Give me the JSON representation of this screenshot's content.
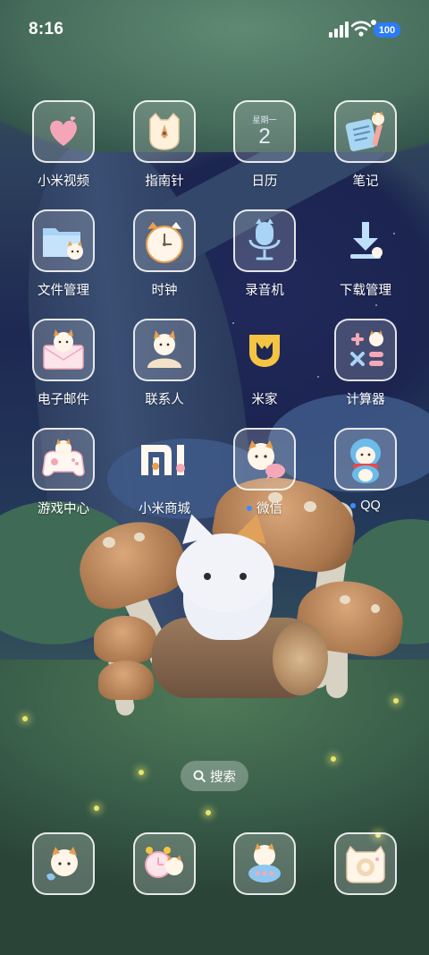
{
  "status_bar": {
    "time": "8:16",
    "battery_level": "100",
    "signal_icon": "cellular-signal-icon",
    "wifi_icon": "wifi-icon"
  },
  "apps": [
    {
      "id": "mi-video",
      "label": "小米视频",
      "icon": "heart-icon"
    },
    {
      "id": "compass",
      "label": "指南针",
      "icon": "compass-icon"
    },
    {
      "id": "calendar",
      "label": "日历",
      "icon": "calendar-icon",
      "weekday": "星期一",
      "day": "2"
    },
    {
      "id": "notes",
      "label": "笔记",
      "icon": "notes-icon"
    },
    {
      "id": "file-manager",
      "label": "文件管理",
      "icon": "folder-icon"
    },
    {
      "id": "clock",
      "label": "时钟",
      "icon": "clock-icon"
    },
    {
      "id": "recorder",
      "label": "录音机",
      "icon": "microphone-icon"
    },
    {
      "id": "downloads",
      "label": "下载管理",
      "icon": "download-icon"
    },
    {
      "id": "email",
      "label": "电子邮件",
      "icon": "envelope-icon"
    },
    {
      "id": "contacts",
      "label": "联系人",
      "icon": "contact-icon"
    },
    {
      "id": "mijia",
      "label": "米家",
      "icon": "mijia-logo-icon"
    },
    {
      "id": "calculator",
      "label": "计算器",
      "icon": "calculator-icon"
    },
    {
      "id": "game-center",
      "label": "游戏中心",
      "icon": "gamepad-icon"
    },
    {
      "id": "mi-store",
      "label": "小米商城",
      "icon": "mi-store-logo-icon"
    },
    {
      "id": "wechat",
      "label": "微信",
      "icon": "chat-bubble-icon",
      "has_notification": true
    },
    {
      "id": "qq",
      "label": "QQ",
      "icon": "penguin-icon",
      "has_notification": true
    }
  ],
  "search": {
    "label": "搜索",
    "icon": "search-icon"
  },
  "dock": [
    {
      "id": "phone",
      "icon": "cat-phone-icon"
    },
    {
      "id": "messages-alarm",
      "icon": "cat-alarm-icon"
    },
    {
      "id": "messages",
      "icon": "cat-message-icon"
    },
    {
      "id": "camera",
      "icon": "cat-camera-icon"
    }
  ],
  "colors": {
    "accent_blue": "#3d8cff",
    "battery_badge": "#2c7cf6",
    "mijia_yellow": "#f4c542"
  }
}
